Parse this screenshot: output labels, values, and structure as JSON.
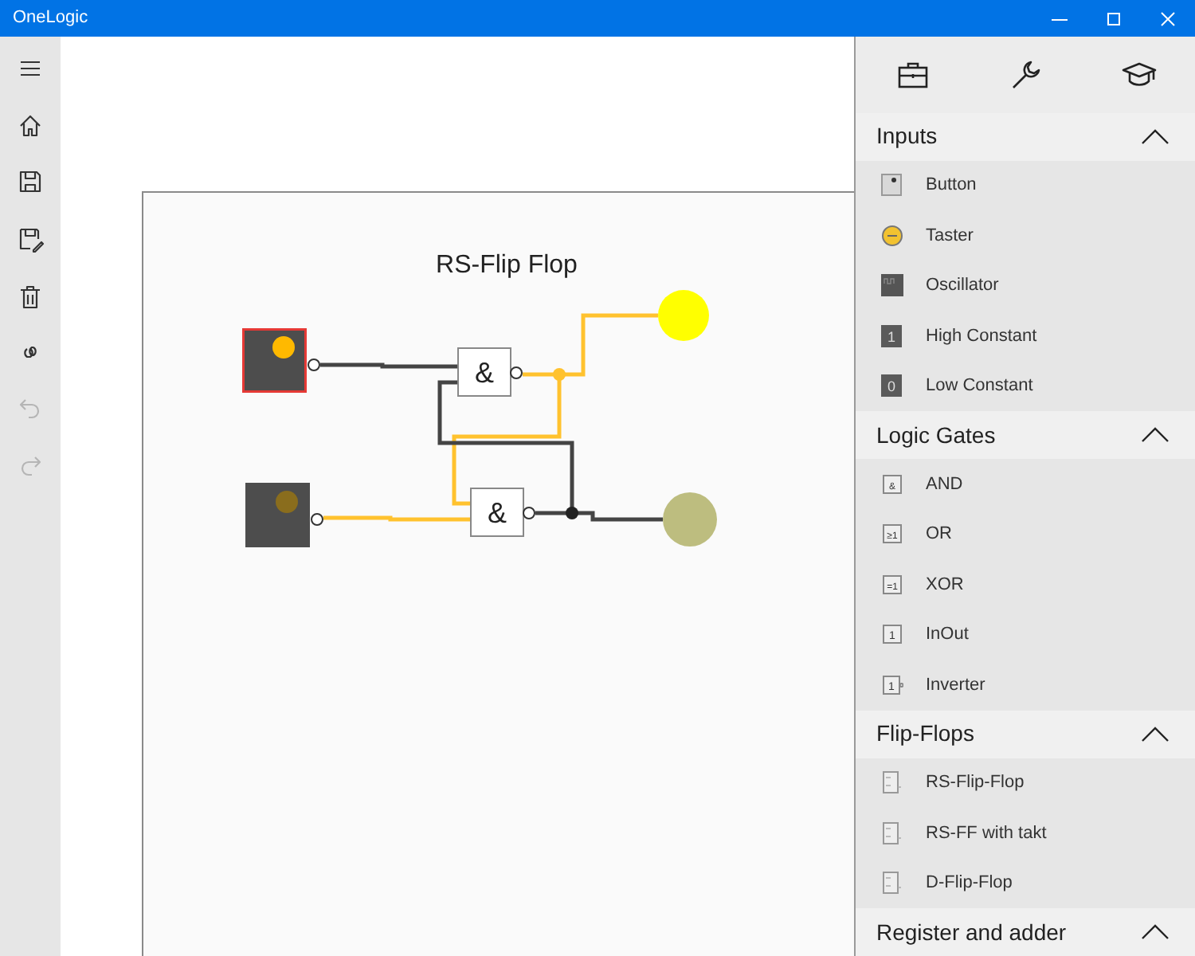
{
  "window": {
    "title": "OneLogic"
  },
  "toolbar": [
    {
      "disabled": false
    },
    {
      "disabled": false
    },
    {
      "disabled": false
    },
    {
      "disabled": false
    },
    {
      "disabled": false
    },
    {
      "disabled": false
    },
    {
      "disabled": true
    },
    {
      "disabled": true
    }
  ],
  "circuit": {
    "title": "RS-Flip Flop",
    "inputs": [
      {
        "on": true,
        "selected": true
      },
      {
        "on": false,
        "selected": false
      }
    ],
    "gates": [
      {
        "symbol": "&"
      },
      {
        "symbol": "&"
      }
    ],
    "lamps": [
      {
        "on": true
      },
      {
        "on": false
      }
    ],
    "wires": [
      {
        "on": false
      },
      {
        "on": true
      },
      {
        "on": true
      },
      {
        "on": false
      },
      {
        "on": false
      },
      {
        "on": true
      }
    ]
  },
  "sections": [
    {
      "title": "Inputs",
      "expanded": true,
      "items": [
        {
          "kind": "button",
          "label": "Button"
        },
        {
          "kind": "taster",
          "label": "Taster"
        },
        {
          "kind": "oscillator",
          "label": "Oscillator"
        },
        {
          "kind": "constant",
          "symbol": "1",
          "label": "High Constant"
        },
        {
          "kind": "constant",
          "symbol": "0",
          "label": "Low Constant"
        }
      ]
    },
    {
      "title": "Logic Gates",
      "expanded": true,
      "items": [
        {
          "kind": "gate",
          "symbol": "&",
          "label": "AND"
        },
        {
          "kind": "gate",
          "symbol": "≥1",
          "label": "OR"
        },
        {
          "kind": "gate",
          "symbol": "=1",
          "label": "XOR"
        },
        {
          "kind": "gate",
          "symbol": "1",
          "label": "InOut"
        },
        {
          "kind": "inverter",
          "symbol": "1",
          "label": "Inverter"
        }
      ]
    },
    {
      "title": "Flip-Flops",
      "expanded": true,
      "items": [
        {
          "kind": "flipflop",
          "label": "RS-Flip-Flop"
        },
        {
          "kind": "flipflop",
          "label": "RS-FF with takt"
        },
        {
          "kind": "flipflop",
          "label": "D-Flip-Flop"
        }
      ]
    },
    {
      "title": "Register and adder",
      "expanded": true
    }
  ]
}
